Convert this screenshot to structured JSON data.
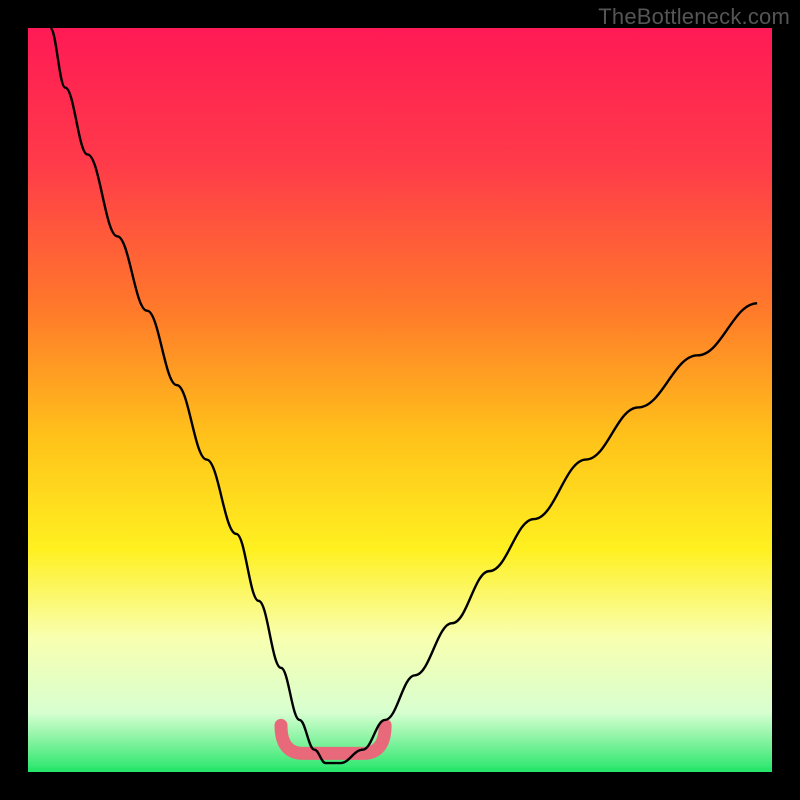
{
  "watermark": "TheBottleneck.com",
  "accent_curve_color": "#000000",
  "bottom_band_color": "#e86a7a",
  "green_strip_color": "#27e66b",
  "chart_data": {
    "type": "line",
    "title": "",
    "xlabel": "",
    "ylabel": "",
    "x_range": [
      0,
      100
    ],
    "y_range": [
      0,
      100
    ],
    "gradient_stops": [
      {
        "pos": 0.0,
        "color": "#ff1a55"
      },
      {
        "pos": 0.18,
        "color": "#ff3a4a"
      },
      {
        "pos": 0.38,
        "color": "#ff7a2a"
      },
      {
        "pos": 0.55,
        "color": "#ffc21a"
      },
      {
        "pos": 0.7,
        "color": "#fff020"
      },
      {
        "pos": 0.82,
        "color": "#f8ffb0"
      },
      {
        "pos": 0.92,
        "color": "#d8ffd0"
      },
      {
        "pos": 1.0,
        "color": "#27e66b"
      }
    ],
    "series": [
      {
        "name": "bottleneck-curve",
        "x": [
          3,
          5,
          8,
          12,
          16,
          20,
          24,
          28,
          31,
          34,
          36.5,
          38.5,
          40,
          42,
          45,
          48,
          52,
          57,
          62,
          68,
          75,
          82,
          90,
          98
        ],
        "y": [
          100,
          92,
          83,
          72,
          62,
          52,
          42,
          32,
          23,
          14,
          7,
          3,
          1.2,
          1.2,
          3,
          7,
          13,
          20,
          27,
          34,
          42,
          49,
          56,
          63
        ]
      }
    ],
    "flat_band": {
      "x_start": 34,
      "x_end": 48,
      "y": 2.5
    },
    "green_strip_y": 0.6
  }
}
